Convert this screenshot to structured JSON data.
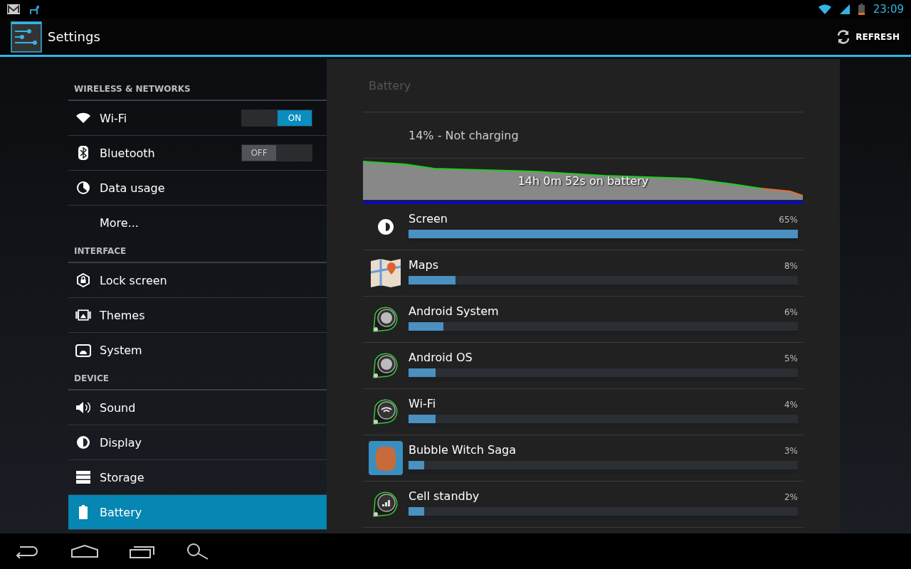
{
  "status_bar": {
    "time": "23:09"
  },
  "action_bar": {
    "title": "Settings",
    "action": "REFRESH"
  },
  "sidebar": {
    "sections": [
      {
        "header": "WIRELESS & NETWORKS",
        "items": [
          {
            "label": "Wi-Fi",
            "selected": false,
            "kind": "toggle",
            "on": true,
            "toggle_label": "ON"
          },
          {
            "label": "Bluetooth",
            "selected": false,
            "kind": "toggle",
            "on": false,
            "toggle_label": "OFF"
          },
          {
            "label": "Data usage",
            "selected": false,
            "kind": "plain"
          },
          {
            "label": "More...",
            "selected": false,
            "kind": "plain"
          }
        ]
      },
      {
        "header": "INTERFACE",
        "items": [
          {
            "label": "Lock screen",
            "selected": false,
            "kind": "plain"
          },
          {
            "label": "Themes",
            "selected": false,
            "kind": "plain"
          },
          {
            "label": "System",
            "selected": false,
            "kind": "plain"
          }
        ]
      },
      {
        "header": "DEVICE",
        "items": [
          {
            "label": "Sound",
            "selected": false,
            "kind": "plain"
          },
          {
            "label": "Display",
            "selected": false,
            "kind": "plain"
          },
          {
            "label": "Storage",
            "selected": false,
            "kind": "plain"
          },
          {
            "label": "Battery",
            "selected": true,
            "kind": "plain"
          }
        ]
      }
    ]
  },
  "battery": {
    "title": "Battery",
    "status": "14% - Not charging",
    "history_label": "14h 0m 52s on battery",
    "usage": [
      {
        "name": "Screen",
        "percent": "65%",
        "level": 1.0
      },
      {
        "name": "Maps",
        "percent": "8%",
        "level": 0.12
      },
      {
        "name": "Android System",
        "percent": "6%",
        "level": 0.09
      },
      {
        "name": "Android OS",
        "percent": "5%",
        "level": 0.07
      },
      {
        "name": "Wi-Fi",
        "percent": "4%",
        "level": 0.07
      },
      {
        "name": "Bubble Witch Saga",
        "percent": "3%",
        "level": 0.04
      },
      {
        "name": "Cell standby",
        "percent": "2%",
        "level": 0.04
      }
    ]
  }
}
